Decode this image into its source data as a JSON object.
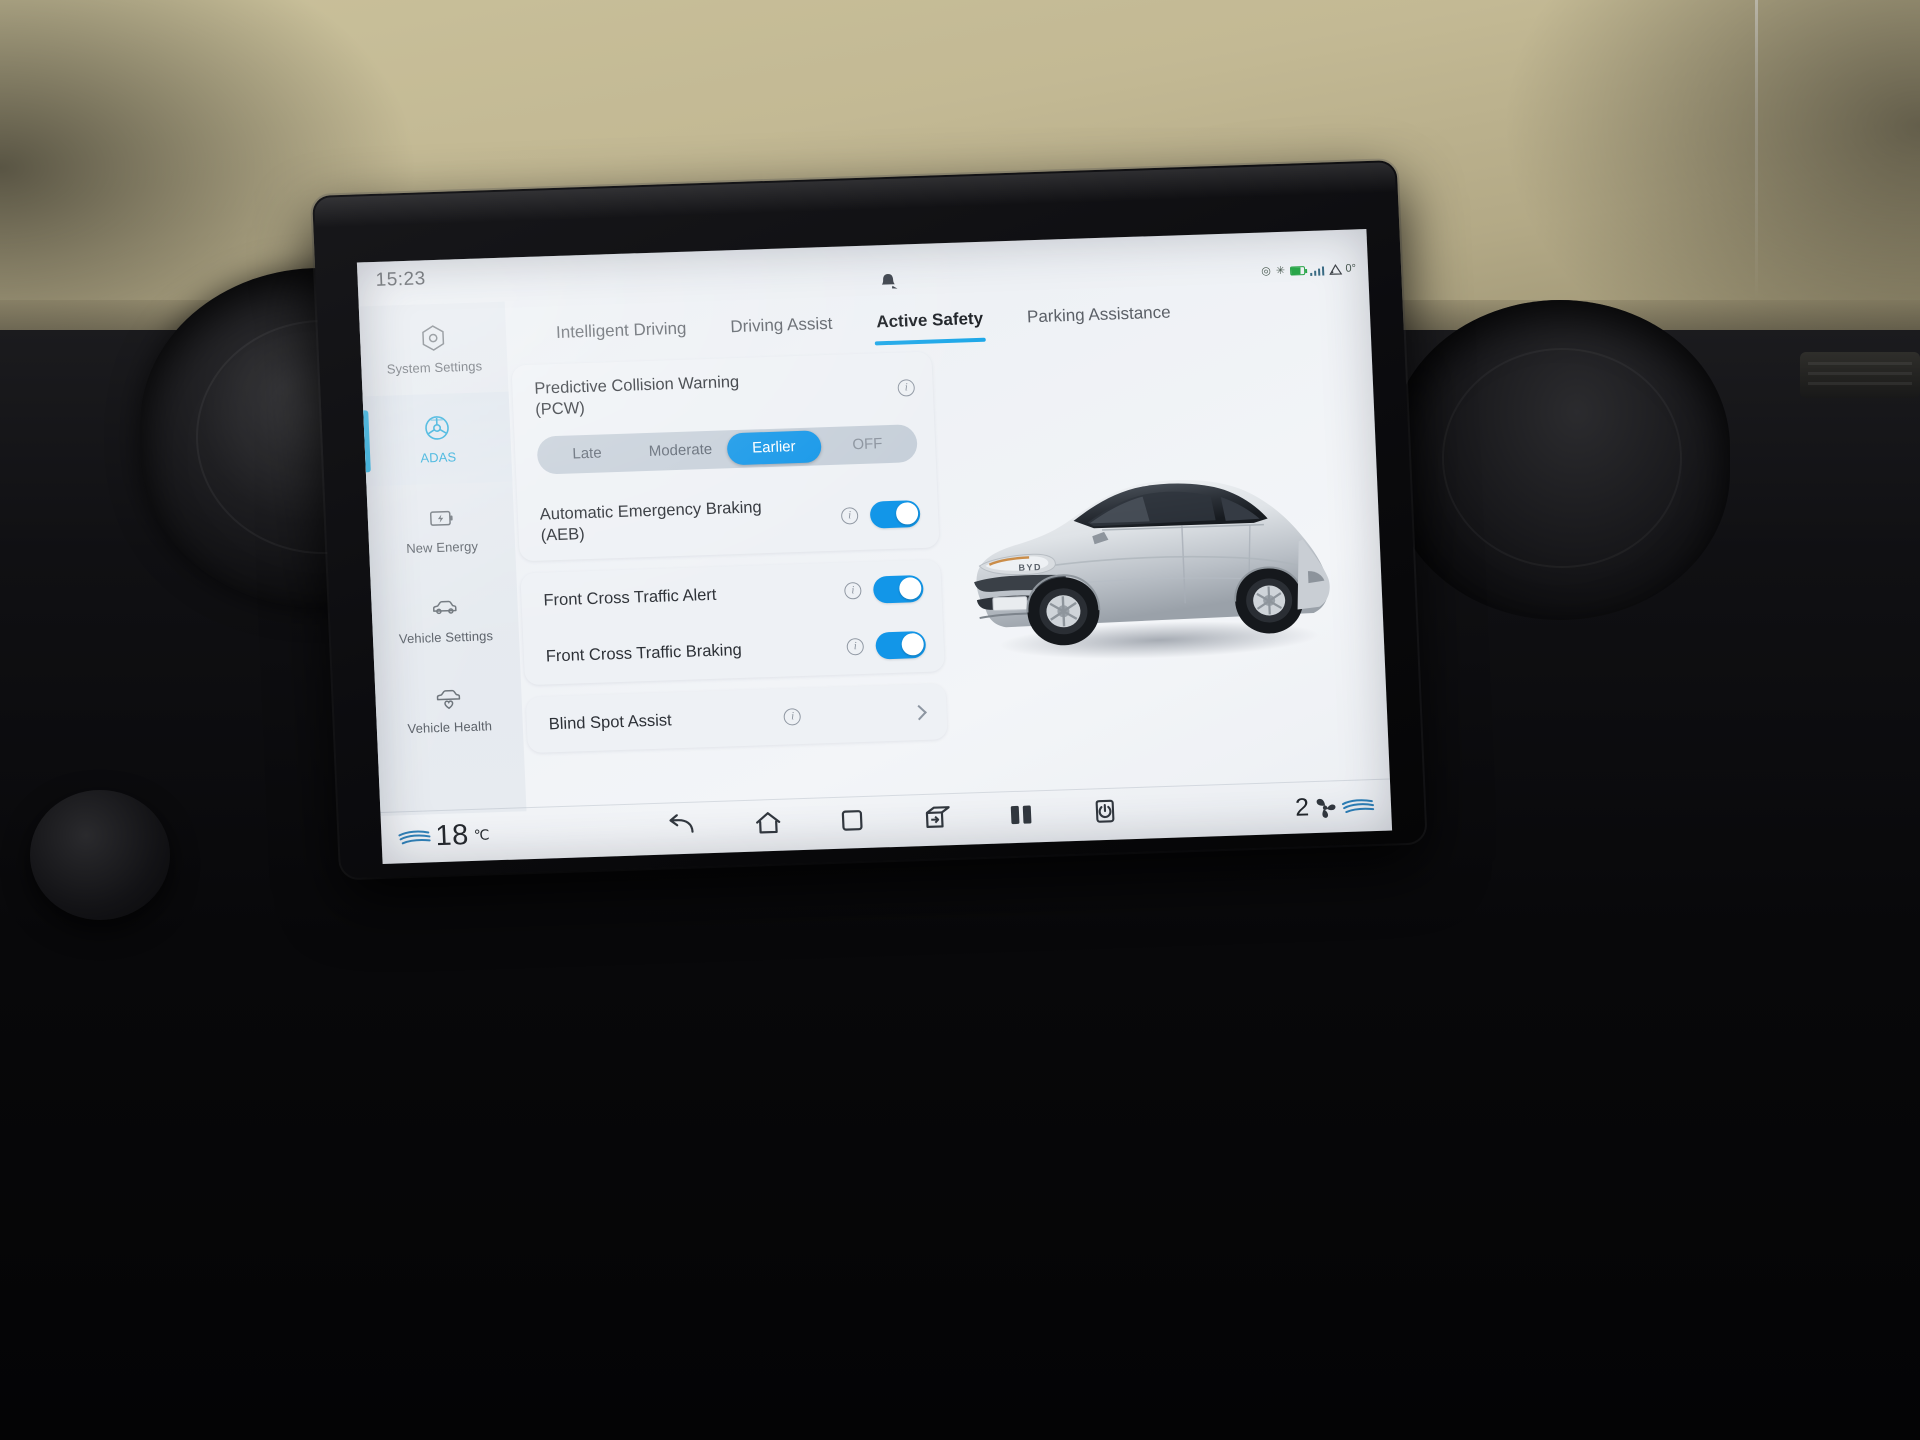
{
  "statusbar": {
    "clock": "15:23",
    "notch_icon": "bell-icon",
    "icons": [
      "location-icon",
      "bluetooth-icon",
      "signal-icon",
      "battery-icon",
      "cellular-icon"
    ],
    "outside_temp": "0°",
    "outside_temp_icon": "warning-triangle-icon"
  },
  "sidebar": {
    "items": [
      {
        "label": "System Settings",
        "icon": "hexagon-gear-icon",
        "active": false
      },
      {
        "label": "ADAS",
        "icon": "steering-wheel-icon",
        "active": true
      },
      {
        "label": "New Energy",
        "icon": "battery-bolt-icon",
        "active": false
      },
      {
        "label": "Vehicle Settings",
        "icon": "car-icon",
        "active": false
      },
      {
        "label": "Vehicle Health",
        "icon": "car-heart-icon",
        "active": false
      }
    ]
  },
  "tabs": [
    {
      "label": "Intelligent Driving",
      "active": false
    },
    {
      "label": "Driving Assist",
      "active": false
    },
    {
      "label": "Active Safety",
      "active": true
    },
    {
      "label": "Parking Assistance",
      "active": false
    }
  ],
  "settings": {
    "pcw": {
      "label": "Predictive Collision Warning (PCW)",
      "info_icon": "info-icon",
      "options": [
        "Late",
        "Moderate",
        "Earlier",
        "OFF"
      ],
      "selected": "Earlier"
    },
    "aeb": {
      "label": "Automatic Emergency Braking (AEB)",
      "info_icon": "info-icon",
      "toggle": "on"
    },
    "fcta": {
      "label": "Front Cross Traffic Alert",
      "info_icon": "info-icon",
      "toggle": "on"
    },
    "fctb": {
      "label": "Front Cross Traffic Braking",
      "info_icon": "info-icon",
      "toggle": "on"
    },
    "blind_spot": {
      "label": "Blind Spot Assist",
      "info_icon": "info-icon",
      "chevron_icon": "chevron-right-icon"
    }
  },
  "car": {
    "brand_badge": "BYD",
    "alt": "silver hatchback vehicle render"
  },
  "navbar": {
    "temperature": "18",
    "temp_unit": "℃",
    "left_icon": "airflow-icon",
    "buttons": [
      {
        "name": "back-button",
        "icon": "back-arrow-icon"
      },
      {
        "name": "home-button",
        "icon": "home-icon"
      },
      {
        "name": "recents-button",
        "icon": "square-icon"
      },
      {
        "name": "screen-mirror-button",
        "icon": "screen-cast-icon"
      },
      {
        "name": "split-screen-button",
        "icon": "split-screen-icon"
      },
      {
        "name": "power-button",
        "icon": "power-icon"
      }
    ],
    "fan_level": "2",
    "fan_icon": "fan-icon",
    "right_icon": "airflow-icon"
  },
  "colors": {
    "accent": "#1296e8",
    "accent_tab": "#1ca7e8",
    "sidebar_active_text": "#1fa7d8",
    "screen_bg": "#eef1f5",
    "segment_track": "#c6cfd9"
  }
}
